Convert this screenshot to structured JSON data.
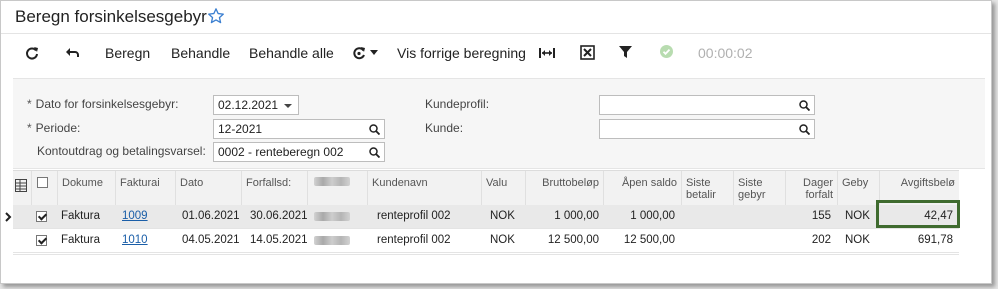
{
  "page": {
    "title": "Beregn forsinkelsesgebyr"
  },
  "toolbar": {
    "beregn": "Beregn",
    "behandle": "Behandle",
    "behandle_alle": "Behandle alle",
    "vis_forrige": "Vis forrige beregning",
    "timer": "00:00:02"
  },
  "form": {
    "dato_label": "Dato for forsinkelsesgebyr:",
    "dato_value": "02.12.2021",
    "periode_label": "Periode:",
    "periode_value": "12-2021",
    "kontoutdrag_label": "Kontoutdrag og betalingsvarsel:",
    "kontoutdrag_value": "0002 - renteberegn 002",
    "kundeprofil_label": "Kundeprofil:",
    "kundeprofil_value": "",
    "kunde_label": "Kunde:",
    "kunde_value": "",
    "required_mark": "*"
  },
  "grid": {
    "headers": {
      "dokument": "Dokume",
      "faktura": "Fakturai",
      "dato": "Dato",
      "forfall": "Forfallsd:",
      "kundenavn": "Kundenavn",
      "valuta": "Valu",
      "brutto": "Bruttobeløp",
      "apen": "Åpen saldo",
      "siste_betal_1": "Siste",
      "siste_betal_2": "betalir",
      "siste_gebyr_1": "Siste",
      "siste_gebyr_2": "gebyr",
      "dager_1": "Dager",
      "dager_2": "forfalt",
      "gebyr": "Geby",
      "avgift": "Avgiftsbelø"
    },
    "rows": [
      {
        "dokument": "Faktura",
        "faktura": "1009",
        "dato": "01.06.2021",
        "forfall": "30.06.2021",
        "kundenavn": "renteprofil 002",
        "valuta": "NOK",
        "brutto": "1 000,00",
        "apen": "1 000,00",
        "dager": "155",
        "gebyr": "NOK",
        "avgift": "42,47",
        "checked": true
      },
      {
        "dokument": "Faktura",
        "faktura": "1010",
        "dato": "04.05.2021",
        "forfall": "14.05.2021",
        "kundenavn": "renteprofil 002",
        "valuta": "NOK",
        "brutto": "12 500,00",
        "apen": "12 500,00",
        "dager": "202",
        "gebyr": "NOK",
        "avgift": "691,78",
        "checked": true
      }
    ]
  },
  "colors": {
    "link": "#1a5ea8",
    "highlight_border": "#3f6b2f",
    "star": "#3b7fd1"
  }
}
